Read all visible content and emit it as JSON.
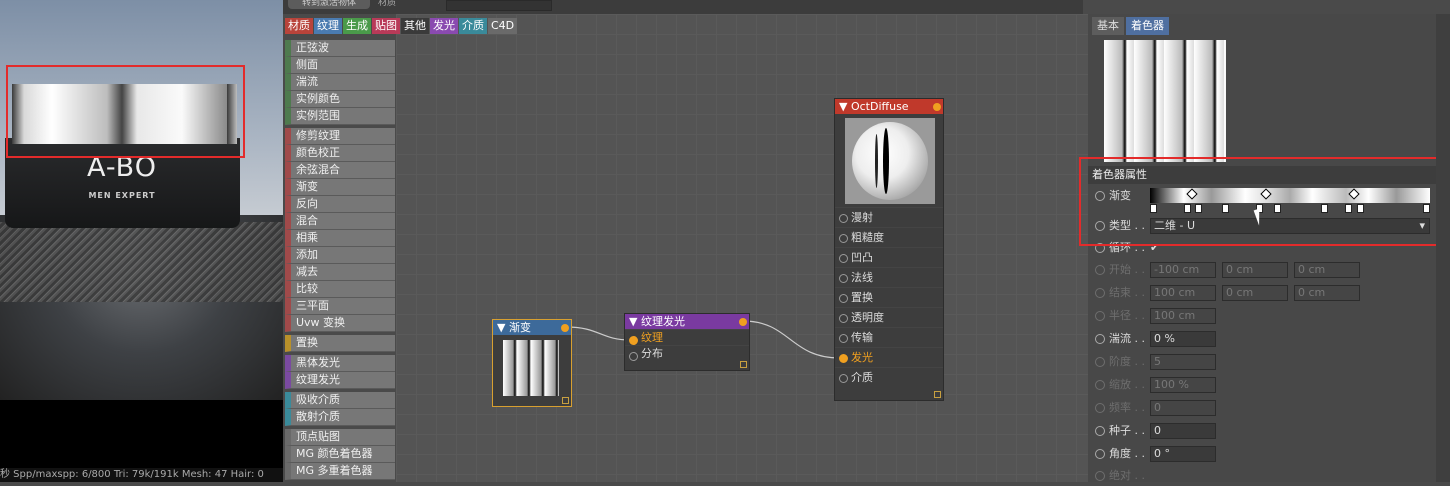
{
  "topbar": {
    "button_label": "转到激活物体",
    "label": "材质",
    "field_value": ""
  },
  "viewport": {
    "brand": "A-BO",
    "brand_sub": "MEN EXPERT",
    "status": "秒  Spp/maxspp: 6/800    Tri: 79k/191k  Mesh: 47   Hair: 0"
  },
  "category_tabs": [
    {
      "label": "材质",
      "color": "#b8433a"
    },
    {
      "label": "纹理",
      "color": "#4a7bb0"
    },
    {
      "label": "生成",
      "color": "#4a9a4a"
    },
    {
      "label": "贴图",
      "color": "#b83a58"
    },
    {
      "label": "其他",
      "color": "#3a3a3a"
    },
    {
      "label": "发光",
      "color": "#8a4ab0"
    },
    {
      "label": "介质",
      "color": "#3a8a9a"
    },
    {
      "label": "C4D",
      "color": "#6a6a6a"
    }
  ],
  "category_list": [
    {
      "label": "正弦波",
      "accent": "#4e7a4e"
    },
    {
      "label": "侧面",
      "accent": "#4e7a4e"
    },
    {
      "label": "湍流",
      "accent": "#4e7a4e"
    },
    {
      "label": "实例颜色",
      "accent": "#4e7a4e"
    },
    {
      "label": "实例范围",
      "accent": "#4e7a4e"
    },
    {
      "label": "修剪纹理",
      "accent": "#a04a4a"
    },
    {
      "label": "颜色校正",
      "accent": "#a04a4a"
    },
    {
      "label": "余弦混合",
      "accent": "#a04a4a"
    },
    {
      "label": "渐变",
      "accent": "#a04a4a"
    },
    {
      "label": "反向",
      "accent": "#a04a4a"
    },
    {
      "label": "混合",
      "accent": "#a04a4a"
    },
    {
      "label": "相乘",
      "accent": "#a04a4a"
    },
    {
      "label": "添加",
      "accent": "#a04a4a"
    },
    {
      "label": "减去",
      "accent": "#a04a4a"
    },
    {
      "label": "比较",
      "accent": "#a04a4a"
    },
    {
      "label": "三平面",
      "accent": "#a04a4a"
    },
    {
      "label": "Uvw 变换",
      "accent": "#a04a4a"
    },
    {
      "label": "置换",
      "accent": "#b8902a"
    },
    {
      "label": "黑体发光",
      "accent": "#7a4aa0"
    },
    {
      "label": "纹理发光",
      "accent": "#7a4aa0"
    },
    {
      "label": "吸收介质",
      "accent": "#3a8a9a"
    },
    {
      "label": "散射介质",
      "accent": "#3a8a9a"
    },
    {
      "label": "顶点贴图",
      "accent": "#6a6a6a"
    },
    {
      "label": "MG 颜色着色器",
      "accent": "#6a6a6a"
    },
    {
      "label": "MG 多重着色器",
      "accent": "#6a6a6a"
    }
  ],
  "nodes": {
    "gradient": {
      "title": "渐变",
      "color": "#3d6a9a"
    },
    "texture_emission": {
      "title": "纹理发光",
      "color": "#7a3aa0",
      "ports": [
        "纹理",
        "分布"
      ]
    },
    "oct_diffuse": {
      "title": "OctDiffuse",
      "color": "#c0392b",
      "ports": [
        "漫射",
        "粗糙度",
        "凹凸",
        "法线",
        "置换",
        "透明度",
        "传输",
        "发光",
        "介质"
      ]
    }
  },
  "right_panel": {
    "tabs": [
      "基本",
      "着色器"
    ],
    "active_tab": "着色器",
    "section_title": "着色器属性",
    "gradient_label": "渐变",
    "type_label": "类型 . .",
    "type_value": "二维 - U",
    "loop_label": "循环 . .",
    "start_label": "开始 . .",
    "start_values": [
      "-100 cm",
      "0 cm",
      "0 cm"
    ],
    "end_label": "结束 . .",
    "end_values": [
      "100 cm",
      "0 cm",
      "0 cm"
    ],
    "radius_label": "半径 . .",
    "radius_value": "100 cm",
    "turb_label": "湍流 . .",
    "turb_value": "0 %",
    "order_label": "阶度 . .",
    "order_value": "5",
    "scale_label": "缩放 . .",
    "scale_value": "100 %",
    "freq_label": "频率 . .",
    "freq_value": "0",
    "seed_label": "种子 . .",
    "seed_value": "0",
    "angle_label": "角度 . .",
    "angle_value": "0 °",
    "absolute_label": "绝对 . ."
  }
}
